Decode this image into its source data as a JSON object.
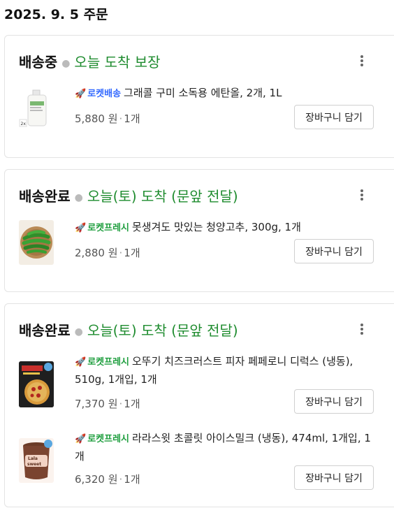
{
  "order": {
    "date_label": "2025. 9. 5 주문"
  },
  "cards": [
    {
      "status": "배송중",
      "eta": "오늘 도착 보장",
      "items": [
        {
          "badge": "로켓배송",
          "badge_type": "rocket-delivery",
          "title": "그래콜 구미 소독용 에탄올, 2개, 1L",
          "price": "5,880 원",
          "qty": "1개",
          "cart_label": "장바구니 담기",
          "thumb_tag": "2x",
          "thumb_icon": "sanitizer-bottle-icon"
        }
      ]
    },
    {
      "status": "배송완료",
      "eta": "오늘(토) 도착 (문앞 전달)",
      "items": [
        {
          "badge": "로켓프레시",
          "badge_type": "rocket-fresh",
          "title": "못생겨도 맛있는 청양고추, 300g, 1개",
          "price": "2,880 원",
          "qty": "1개",
          "cart_label": "장바구니 담기",
          "thumb_icon": "green-chili-basket-icon"
        }
      ]
    },
    {
      "status": "배송완료",
      "eta": "오늘(토) 도착 (문앞 전달)",
      "items": [
        {
          "badge": "로켓프레시",
          "badge_type": "rocket-fresh",
          "title": "오뚜기 치즈크러스트 피자 페페로니 디럭스 (냉동), 510g, 1개입, 1개",
          "price": "7,370 원",
          "qty": "1개",
          "cart_label": "장바구니 담기",
          "thumb_icon": "frozen-pizza-box-icon"
        },
        {
          "badge": "로켓프레시",
          "badge_type": "rocket-fresh",
          "title": "라라스윗 초콜릿 아이스밀크 (냉동), 474ml, 1개입, 1개",
          "price": "6,320 원",
          "qty": "1개",
          "cart_label": "장바구니 담기",
          "thumb_text": "Lala sweet",
          "thumb_icon": "ice-cream-tub-icon"
        }
      ]
    }
  ],
  "colors": {
    "eta_green": "#1f8c2f",
    "rocket_blue": "#346aff",
    "fresh_green": "#1e9e3e"
  }
}
